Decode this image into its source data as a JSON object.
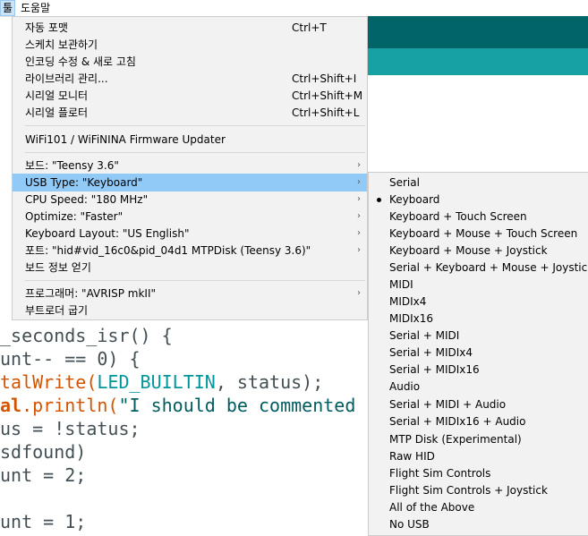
{
  "menubar": {
    "tools_label": "툴",
    "help_label": "도움말"
  },
  "tools_menu": {
    "items": [
      {
        "label": "자동 포맷",
        "shortcut": "Ctrl+T"
      },
      {
        "label": "스케치 보관하기",
        "shortcut": ""
      },
      {
        "label": "인코딩 수정 & 새로 고침",
        "shortcut": ""
      },
      {
        "label": "라이브러리 관리...",
        "shortcut": "Ctrl+Shift+I"
      },
      {
        "label": "시리얼 모니터",
        "shortcut": "Ctrl+Shift+M"
      },
      {
        "label": "시리얼 플로터",
        "shortcut": "Ctrl+Shift+L"
      },
      {
        "label": "WiFi101 / WiFiNINA Firmware Updater",
        "shortcut": ""
      },
      {
        "label": "보드: \"Teensy 3.6\"",
        "shortcut": ""
      },
      {
        "label": "USB Type: \"Keyboard\"",
        "shortcut": ""
      },
      {
        "label": "CPU Speed: \"180 MHz\"",
        "shortcut": ""
      },
      {
        "label": "Optimize: \"Faster\"",
        "shortcut": ""
      },
      {
        "label": "Keyboard Layout: \"US English\"",
        "shortcut": ""
      },
      {
        "label": "포트: \"hid#vid_16c0&pid_04d1 MTPDisk (Teensy 3.6)\"",
        "shortcut": ""
      },
      {
        "label": "보드 정보 얻기",
        "shortcut": ""
      },
      {
        "label": "프로그래머: \"AVRISP mkII\"",
        "shortcut": ""
      },
      {
        "label": "부트로더 굽기",
        "shortcut": ""
      }
    ],
    "arrow_glyph": "›"
  },
  "usb_type_submenu": {
    "selected": "Keyboard",
    "items": [
      "Serial",
      "Keyboard",
      "Keyboard + Touch Screen",
      "Keyboard + Mouse + Touch Screen",
      "Keyboard + Mouse + Joystick",
      "Serial + Keyboard + Mouse + Joystick",
      "MIDI",
      "MIDIx4",
      "MIDIx16",
      "Serial + MIDI",
      "Serial + MIDIx4",
      "Serial + MIDIx16",
      "Audio",
      "Serial + MIDI + Audio",
      "Serial + MIDIx16 + Audio",
      "MTP Disk (Experimental)",
      "Raw HID",
      "Flight Sim Controls",
      "Flight Sim Controls + Joystick",
      "All of the Above",
      "No USB"
    ]
  },
  "code": {
    "line1": "_seconds_isr() {",
    "line2": "unt-- == 0) {",
    "line3_fn": "talWrite(",
    "line3_const": "LED_BUILTIN",
    "line3_rest": ", status);",
    "line4_obj": "al",
    "line4_fn": ".println(",
    "line4_str": "\"I should be commented",
    "line5": "us = !status;",
    "line6": "sdfound)",
    "line7": "unt = 2;",
    "line8": "unt = 1;"
  },
  "colors": {
    "header_dark": "#006468",
    "header_light": "#17a1a5",
    "menu_highlight": "#91c9f7",
    "menu_background": "#f2f2f2"
  }
}
